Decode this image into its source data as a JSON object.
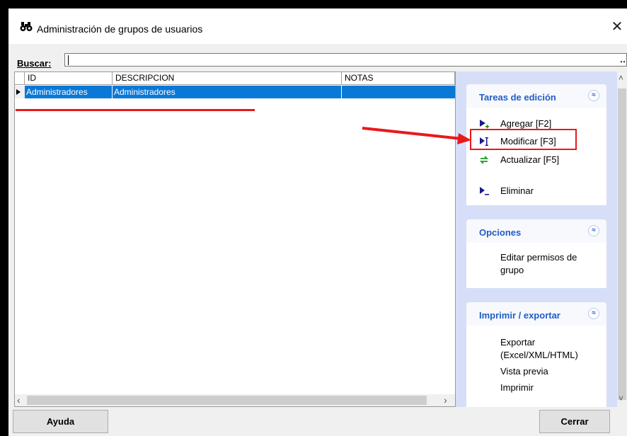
{
  "window": {
    "title": "Administración de grupos de usuarios",
    "close_label": "✕"
  },
  "search": {
    "label": "Buscar:",
    "value": "",
    "more": "‥"
  },
  "grid": {
    "columns": [
      "ID",
      "DESCRIPCION",
      "NOTAS"
    ],
    "rows": [
      {
        "id": "Administradores",
        "descripcion": "Administradores",
        "notas": ""
      }
    ]
  },
  "scroll": {
    "left_arrow": "‹",
    "right_arrow": "›",
    "up_arrow": "˄",
    "down_arrow": "˅"
  },
  "panel": {
    "tareas": {
      "title": "Tareas de edición",
      "items": [
        {
          "label": "Agregar  [F2]",
          "icon": "add-icon"
        },
        {
          "label": "Modificar  [F3]",
          "icon": "edit-icon"
        },
        {
          "label": "Actualizar [F5]",
          "icon": "refresh-icon"
        },
        {
          "label": "Eliminar",
          "icon": "delete-icon"
        }
      ]
    },
    "opciones": {
      "title": "Opciones",
      "items": [
        "Editar permisos de grupo"
      ]
    },
    "imprimir": {
      "title": "Imprimir / exportar",
      "items": [
        "Exportar (Excel/XML/HTML)",
        "Vista previa",
        "Imprimir"
      ]
    },
    "collapse_glyph": "≈"
  },
  "buttons": {
    "help": "Ayuda",
    "close": "Cerrar"
  },
  "colors": {
    "accent": "#215dc6",
    "selection": "#0a78d7",
    "annotation": "#e8191b",
    "panel_bg": "#d6dff7"
  }
}
